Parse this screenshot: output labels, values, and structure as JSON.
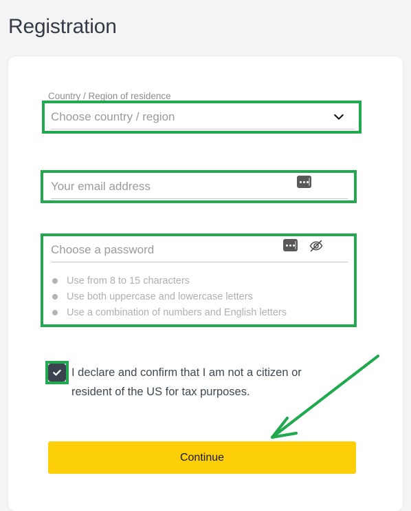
{
  "page": {
    "title": "Registration",
    "background_color": "#f4f4f4",
    "card_color": "#ffffff"
  },
  "annotation": {
    "color": "#22a94f",
    "arrow_name": "green-arrow-pointing-to-continue",
    "boxes": [
      "country-select",
      "email-input",
      "password-block",
      "declaration-checkbox"
    ]
  },
  "form": {
    "country": {
      "label": "Country / Region of residence",
      "placeholder": "Choose country / region",
      "value": "",
      "icon": "chevron-down-icon"
    },
    "email": {
      "placeholder": "Your email address",
      "value": "",
      "icon": "autofill-dots-icon"
    },
    "password": {
      "placeholder": "Choose a password",
      "value": "",
      "icons": [
        "autofill-dots-icon",
        "eye-off-icon"
      ],
      "hints": [
        "Use from 8 to 15 characters",
        "Use both uppercase and lowercase letters",
        "Use a combination of numbers and English letters"
      ]
    },
    "declaration": {
      "checked": true,
      "text": "I declare and confirm that I am not a citizen or resident of the US for tax purposes."
    },
    "submit": {
      "label": "Continue",
      "color": "#fdcf08"
    }
  }
}
